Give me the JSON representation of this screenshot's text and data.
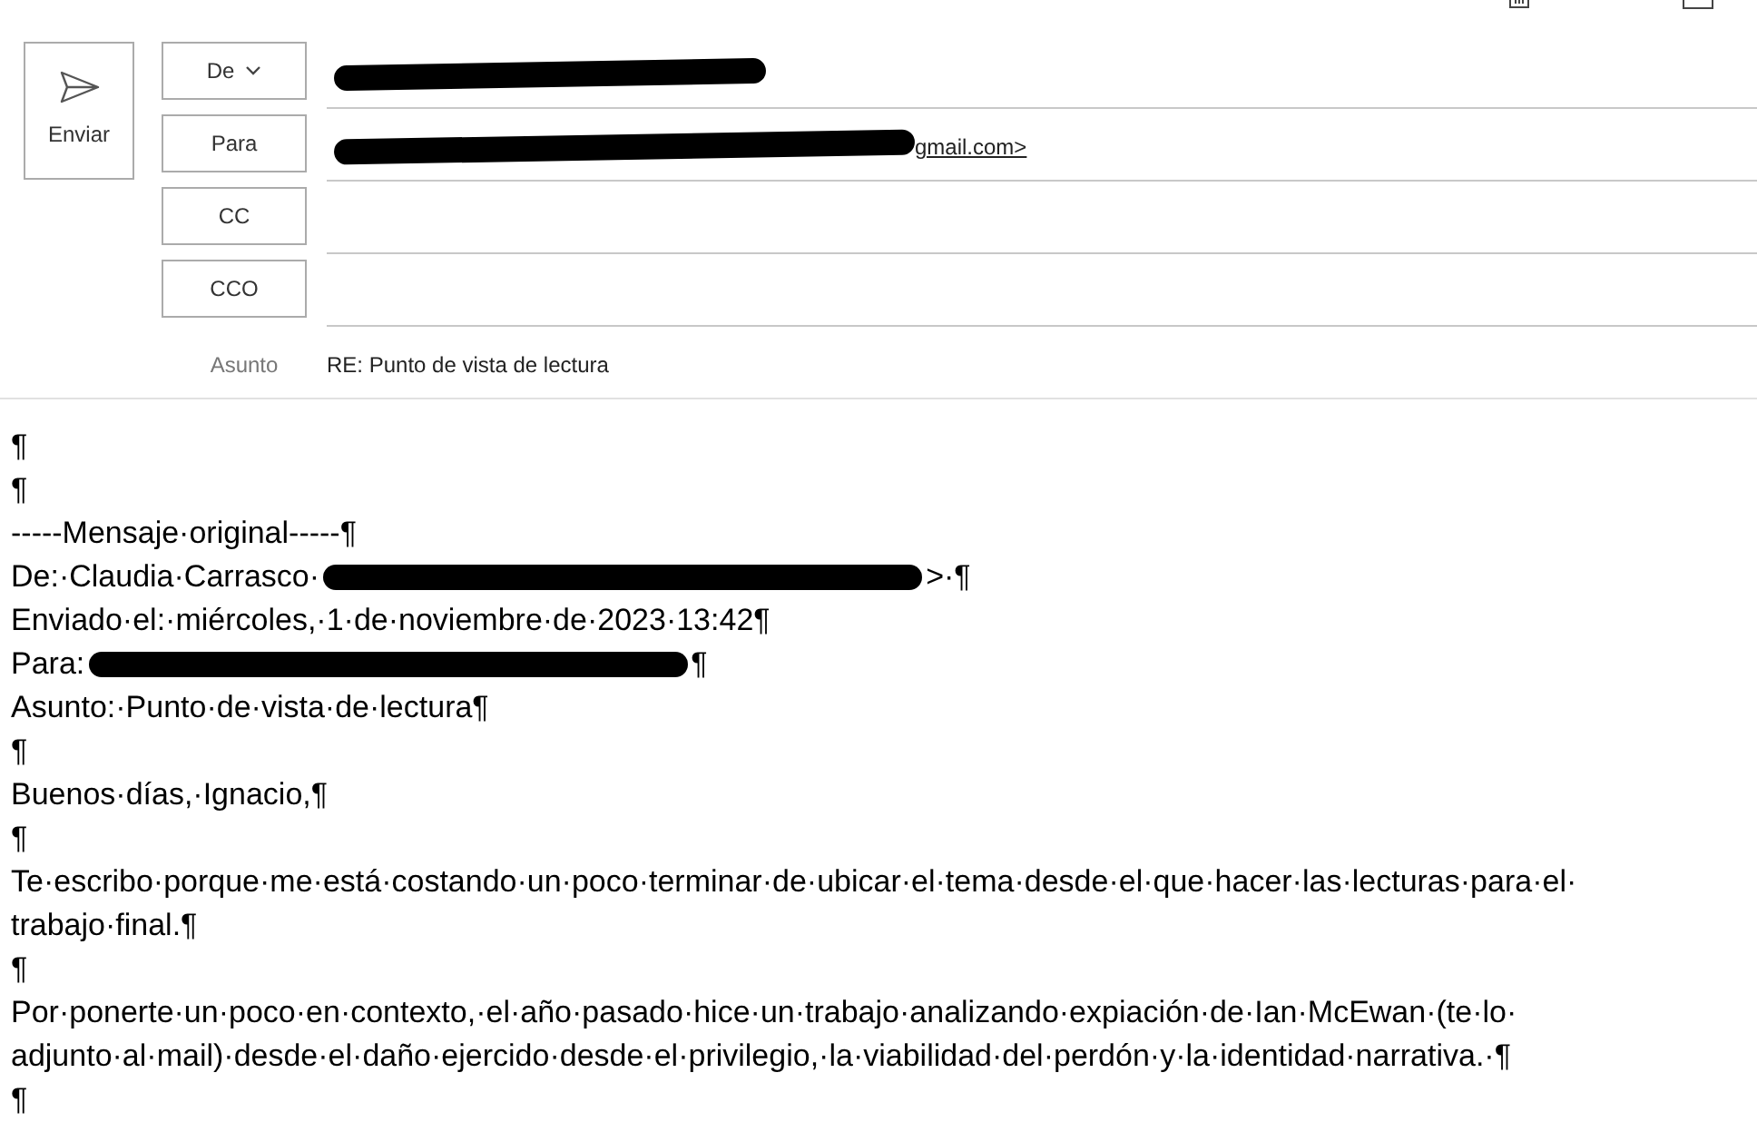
{
  "send_button": {
    "label": "Enviar"
  },
  "fields": [
    {
      "kind": "from",
      "label": "De",
      "redacted": true
    },
    {
      "kind": "to",
      "label": "Para",
      "redacted": true,
      "value": "gmail.com>"
    },
    {
      "kind": "cc",
      "label": "CC"
    },
    {
      "kind": "bcc",
      "label": "CCO"
    }
  ],
  "subject": {
    "label": "Asunto",
    "value": "RE: Punto de vista de lectura"
  },
  "body": [
    {
      "parts": [
        {
          "kind": "text",
          "text": "¶"
        }
      ]
    },
    {
      "parts": [
        {
          "kind": "text",
          "text": "¶"
        }
      ]
    },
    {
      "parts": [
        {
          "kind": "text",
          "text": "-----Mensaje·original-----¶"
        }
      ]
    },
    {
      "parts": [
        {
          "kind": "text",
          "text": "De:·Claudia·Carrasco·"
        },
        {
          "kind": "redaction"
        },
        {
          "kind": "text",
          "text": ">·¶"
        }
      ]
    },
    {
      "parts": [
        {
          "kind": "text",
          "text": "Enviado·el:·miércoles,·1·de·noviembre·de·2023·13:42"
        },
        {
          "kind": "text",
          "text": "¶"
        }
      ]
    },
    {
      "parts": [
        {
          "kind": "text",
          "text": "Para:"
        },
        {
          "kind": "redaction"
        },
        {
          "kind": "text",
          "text": "¶"
        }
      ]
    },
    {
      "parts": [
        {
          "kind": "text",
          "text": "Asunto:·Punto·de·vista·de·lectura¶"
        }
      ]
    },
    {
      "parts": [
        {
          "kind": "text",
          "text": "¶"
        }
      ]
    },
    {
      "parts": [
        {
          "kind": "text",
          "text": "Buenos·días,·Ignacio,¶"
        }
      ]
    },
    {
      "parts": [
        {
          "kind": "text",
          "text": "¶"
        }
      ]
    },
    {
      "parts": [
        {
          "kind": "text",
          "text": "Te·escribo·porque·me·está·costando·un·poco·terminar·de·ubicar·el·tema·desde·el·que·hacer·las·lecturas·para·el· trabajo·final.¶"
        }
      ]
    },
    {
      "parts": [
        {
          "kind": "text",
          "text": "¶"
        }
      ]
    },
    {
      "parts": [
        {
          "kind": "text",
          "text": "Por·ponerte·un·poco·en·contexto,·el·año·pasado·hice·un·trabajo·analizando·expiación·de·Ian·McEwan·(te·lo· adjunto·al·mail)·desde·el·daño·ejercido·desde·el·privilegio,·la·viabilidad·del·perdón·y·la·identidad·narrativa.·¶"
        }
      ]
    },
    {
      "parts": [
        {
          "kind": "text",
          "text": "¶"
        }
      ]
    }
  ]
}
